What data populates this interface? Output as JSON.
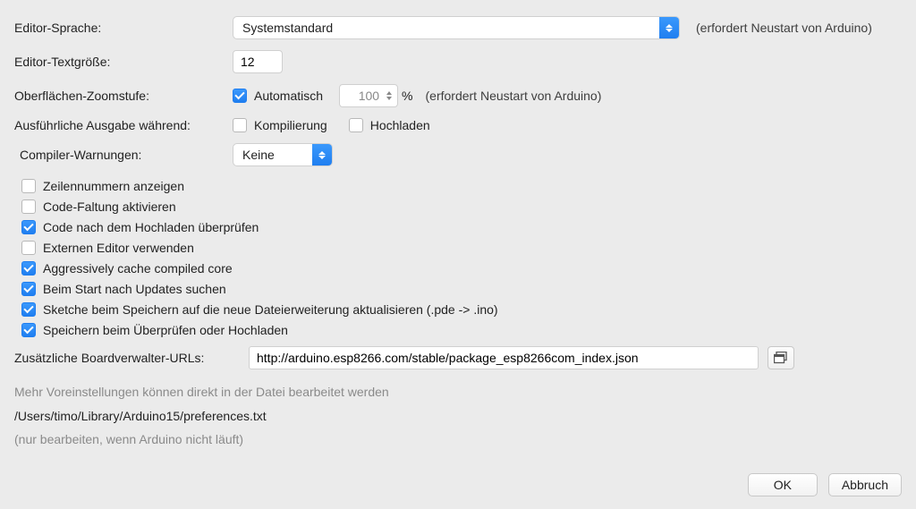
{
  "labels": {
    "editor_language": "Editor-Sprache:",
    "editor_textsize": "Editor-Textgröße:",
    "interface_zoom": "Oberflächen-Zoomstufe:",
    "verbose_output": "Ausführliche Ausgabe während:",
    "compiler_warnings": "Compiler-Warnungen:",
    "additional_urls": "Zusätzliche Boardverwalter-URLs:"
  },
  "editor_language": {
    "value": "Systemstandard",
    "restart_hint": "(erfordert Neustart von Arduino)"
  },
  "editor_textsize": {
    "value": "12"
  },
  "zoom": {
    "auto_label": "Automatisch",
    "auto_checked": true,
    "value": "100",
    "percent": "%",
    "restart_hint": "(erfordert Neustart von Arduino)"
  },
  "verbose": {
    "compile_label": "Kompilierung",
    "compile_checked": false,
    "upload_label": "Hochladen",
    "upload_checked": false
  },
  "compiler_warnings": {
    "value": "Keine"
  },
  "checks": [
    {
      "label": "Zeilennummern anzeigen",
      "checked": false
    },
    {
      "label": "Code-Faltung aktivieren",
      "checked": false
    },
    {
      "label": "Code nach dem Hochladen überprüfen",
      "checked": true
    },
    {
      "label": "Externen Editor verwenden",
      "checked": false
    },
    {
      "label": "Aggressively cache compiled core",
      "checked": true
    },
    {
      "label": "Beim Start nach Updates suchen",
      "checked": true
    },
    {
      "label": "Sketche beim Speichern auf die neue Dateierweiterung aktualisieren (.pde -> .ino)",
      "checked": true
    },
    {
      "label": "Speichern beim Überprüfen oder Hochladen",
      "checked": true
    }
  ],
  "urls": {
    "value": "http://arduino.esp8266.com/stable/package_esp8266com_index.json"
  },
  "footer": {
    "more_prefs": "Mehr Voreinstellungen können direkt in der Datei bearbeitet werden",
    "path": "/Users/timo/Library/Arduino15/preferences.txt",
    "note": "(nur bearbeiten, wenn Arduino nicht läuft)"
  },
  "buttons": {
    "ok": "OK",
    "cancel": "Abbruch"
  }
}
